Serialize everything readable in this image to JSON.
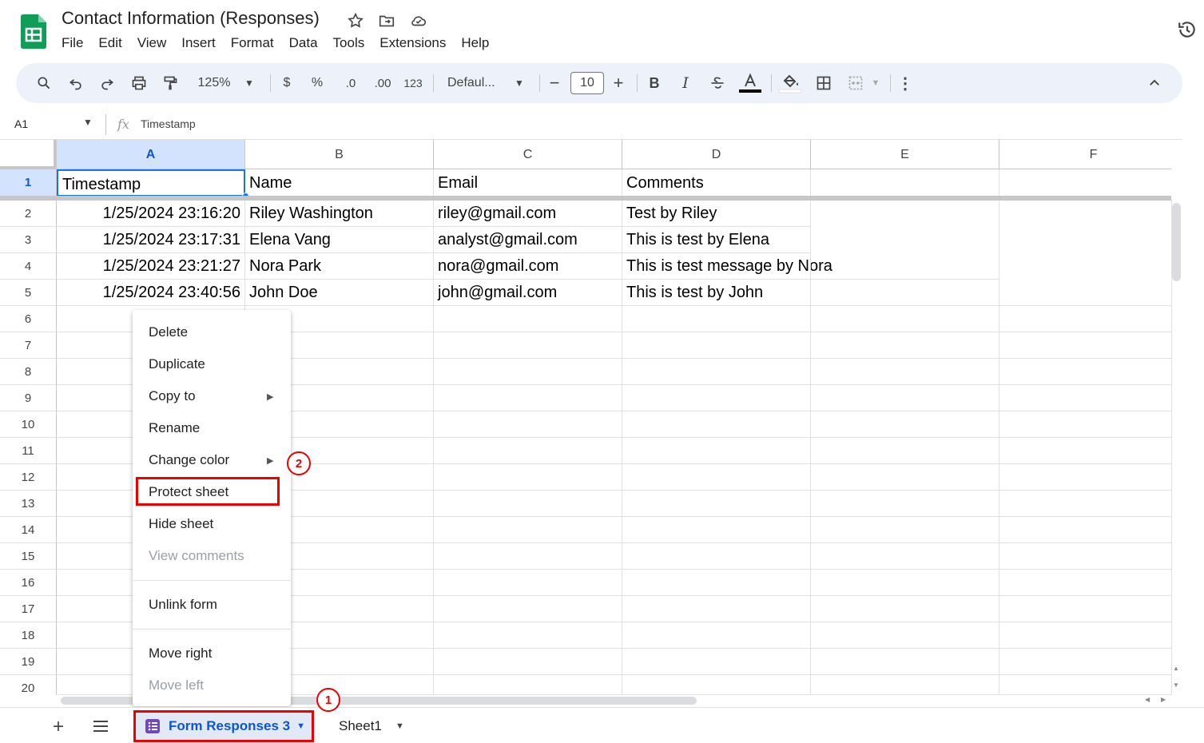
{
  "app": {
    "title": "Contact Information (Responses)"
  },
  "menubar": [
    "File",
    "Edit",
    "View",
    "Insert",
    "Format",
    "Data",
    "Tools",
    "Extensions",
    "Help"
  ],
  "toolbar": {
    "zoom": "125%",
    "currency": "$",
    "percent": "%",
    "dec_decrease": ".0",
    "dec_increase": ".00",
    "number_format": "123",
    "font": "Defaul...",
    "font_size": "10",
    "bold": "B",
    "italic": "I"
  },
  "formula": {
    "cell_ref": "A1",
    "fx": "fx",
    "value": "Timestamp"
  },
  "columns": [
    "A",
    "B",
    "C",
    "D",
    "E",
    "F"
  ],
  "rows": [
    "1",
    "2",
    "3",
    "4",
    "5",
    "6",
    "7",
    "8",
    "9",
    "10",
    "11",
    "12",
    "13",
    "14",
    "15",
    "16",
    "17",
    "18",
    "19",
    "20"
  ],
  "data": [
    [
      "Timestamp",
      "Name",
      "Email",
      "Comments"
    ],
    [
      "1/25/2024 23:16:20",
      "Riley Washington",
      "riley@gmail.com",
      "Test by Riley"
    ],
    [
      "1/25/2024 23:17:31",
      "Elena Vang",
      "analyst@gmail.com",
      "This is test by Elena"
    ],
    [
      "1/25/2024 23:21:27",
      "Nora Park",
      "nora@gmail.com",
      "This is test message by Nora"
    ],
    [
      "1/25/2024 23:40:56",
      "John Doe",
      "john@gmail.com",
      "This is test by John"
    ]
  ],
  "context_menu": {
    "delete": "Delete",
    "duplicate": "Duplicate",
    "copy_to": "Copy to",
    "rename": "Rename",
    "change_color": "Change color",
    "protect_sheet": "Protect sheet",
    "hide_sheet": "Hide sheet",
    "view_comments": "View comments",
    "unlink_form": "Unlink form",
    "move_right": "Move right",
    "move_left": "Move left"
  },
  "tabs": {
    "active": "Form Responses 3",
    "other": "Sheet1"
  },
  "annotations": {
    "step1": "1",
    "step2": "2"
  },
  "colors": {
    "accent": "#0b57d0",
    "highlight": "#ee0000",
    "sheets_green": "#0f9d58",
    "form_purple": "#7248b9"
  }
}
